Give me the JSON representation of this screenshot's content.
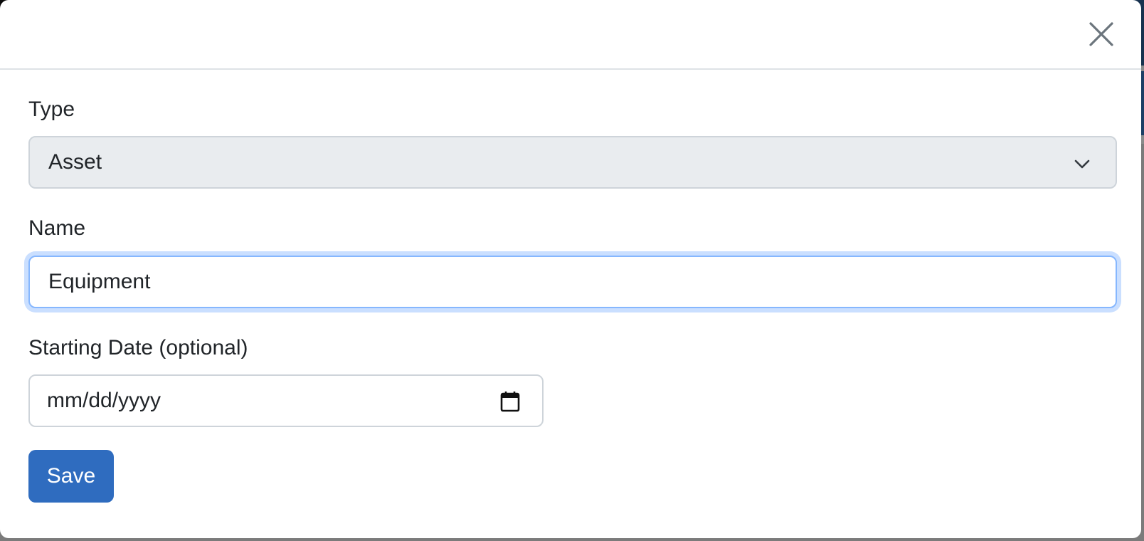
{
  "modal": {
    "close_icon": "close-icon",
    "fields": {
      "type": {
        "label": "Type",
        "selected": "Asset",
        "icon": "chevron-down-icon"
      },
      "name": {
        "label": "Name",
        "value": "Equipment"
      },
      "starting_date": {
        "label": "Starting Date (optional)",
        "placeholder": "mm/dd/yyyy",
        "icon": "calendar-icon"
      }
    },
    "save_label": "Save"
  },
  "colors": {
    "primary_button": "#2f6cbf",
    "select_background": "#e9ecef",
    "focus_border": "#86b7fe",
    "border": "#ced4da",
    "text": "#212529",
    "close_icon": "#6c757d"
  }
}
